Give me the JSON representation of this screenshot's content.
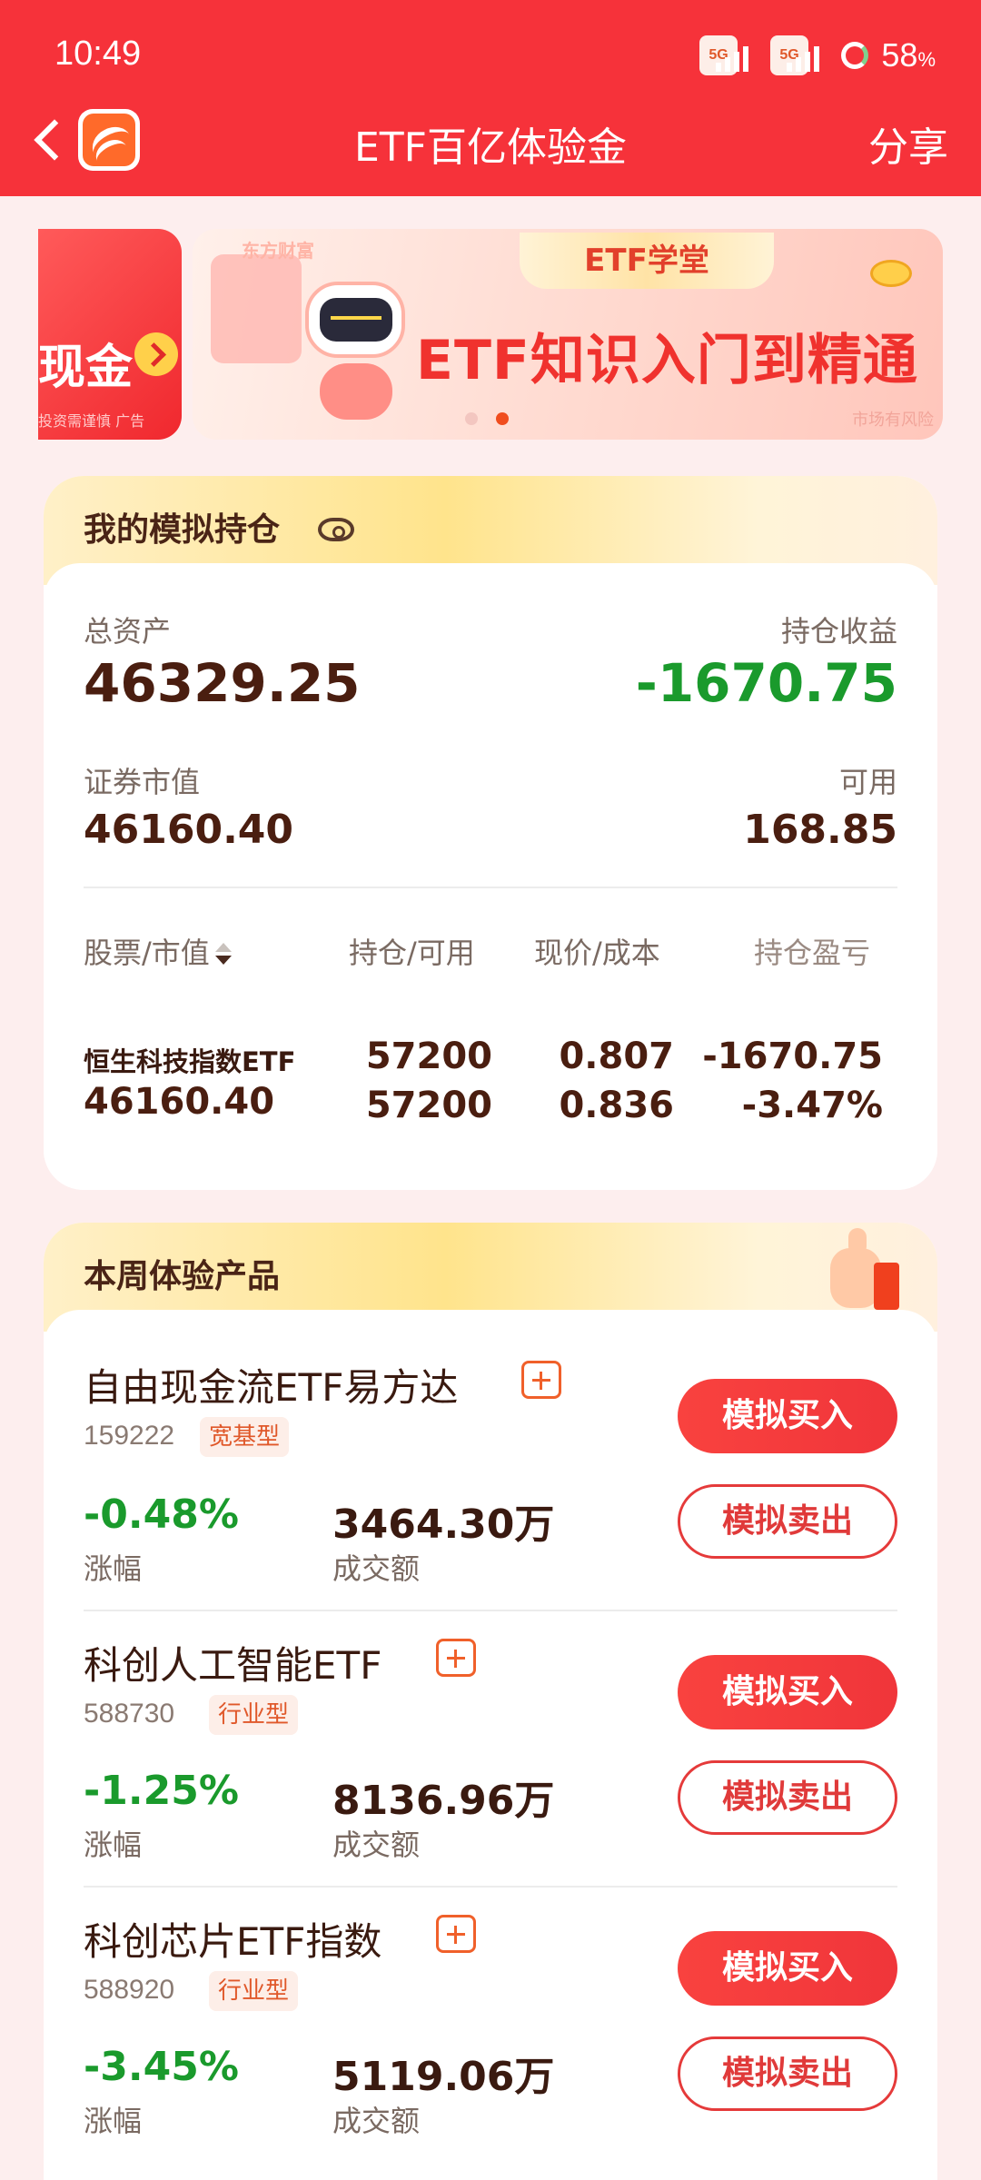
{
  "status": {
    "time": "10:49",
    "network1": "5G",
    "network2": "5G",
    "battery": "58",
    "battery_unit": "%"
  },
  "header": {
    "title": "ETF百亿体验金",
    "share_label": "分享"
  },
  "banner": {
    "left_text": "现金",
    "left_note": "投资需谨慎 广告",
    "brand": "东方财富",
    "badge": "ETF学堂",
    "headline": "ETF知识入门到精通",
    "risk_note": "市场有风险"
  },
  "holdings": {
    "title": "我的模拟持仓",
    "total_assets_label": "总资产",
    "total_assets_value": "46329.25",
    "holding_profit_label": "持仓收益",
    "holding_profit_value": "-1670.75",
    "market_value_label": "证券市值",
    "market_value_value": "46160.40",
    "available_label": "可用",
    "available_value": "168.85",
    "columns": [
      "股票/市值",
      "持仓/可用",
      "现价/成本",
      "持仓盈亏"
    ],
    "rows": [
      {
        "name": "恒生科技指数ETF",
        "market_value": "46160.40",
        "position": "57200",
        "available": "57200",
        "price": "0.807",
        "cost": "0.836",
        "profit": "-1670.75",
        "profit_pct": "-3.47%"
      }
    ]
  },
  "products": {
    "title": "本周体验产品",
    "change_label": "涨幅",
    "volume_label": "成交额",
    "buy_label": "模拟买入",
    "sell_label": "模拟卖出",
    "items": [
      {
        "name": "自由现金流ETF易方达",
        "code": "159222",
        "tag": "宽基型",
        "change": "-0.48%",
        "volume": "3464.30万"
      },
      {
        "name": "科创人工智能ETF",
        "code": "588730",
        "tag": "行业型",
        "change": "-1.25%",
        "volume": "8136.96万"
      },
      {
        "name": "科创芯片ETF指数",
        "code": "588920",
        "tag": "行业型",
        "change": "-3.45%",
        "volume": "5119.06万"
      }
    ]
  },
  "colors": {
    "brand_red": "#f6323a",
    "loss_green": "#1a9a2c",
    "accent_orange": "#f0602a"
  }
}
